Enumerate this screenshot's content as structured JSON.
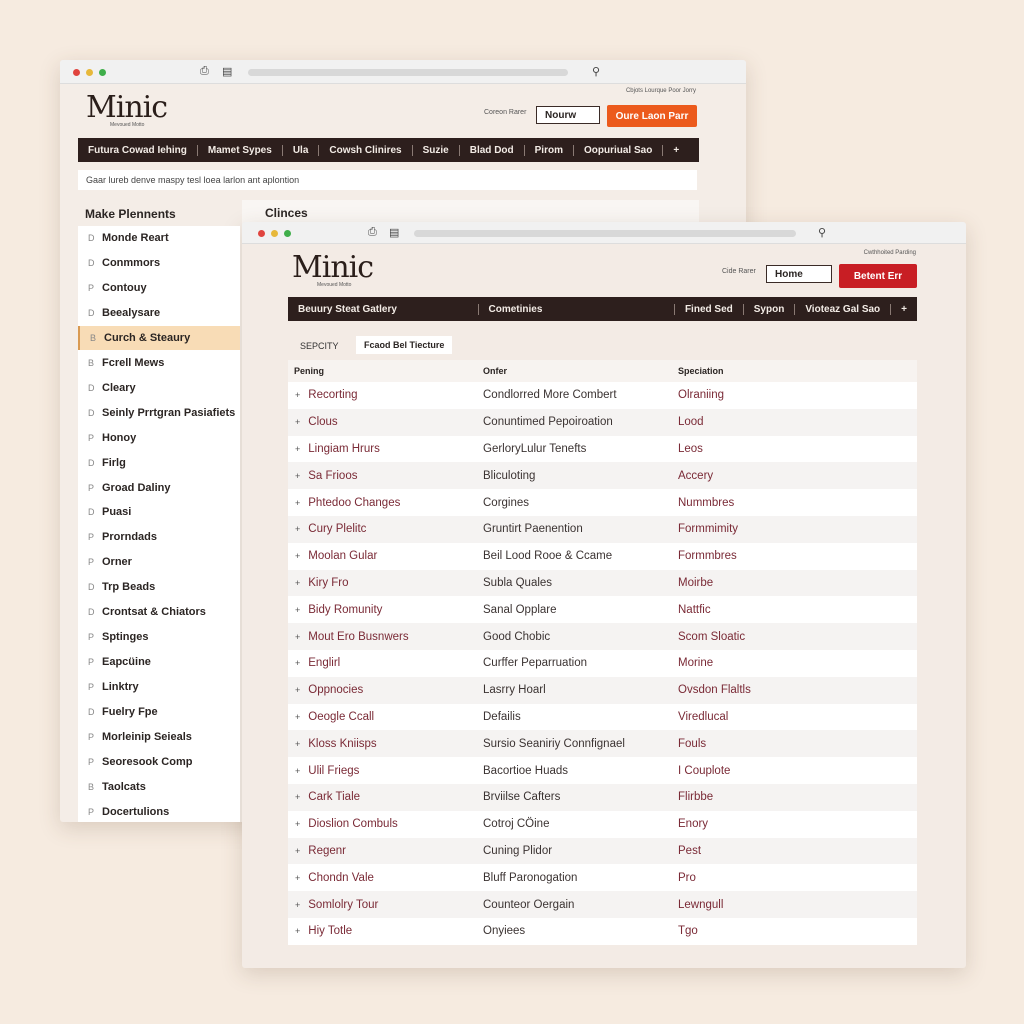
{
  "back_window": {
    "logo": "Minic",
    "logo_sub": "Mevoued Motto",
    "top_right_text": "Cbjots Lourque Poor Jorry",
    "search_label": "Coreon Rarer",
    "search_value": "Nourw",
    "cta_label": "Oure Laon Parr",
    "cta_color": "#ec5a1c",
    "nav": [
      "Futura  Cowad Iehing",
      "Mamet Sypes",
      "Ula",
      "Cowsh Clinires",
      "Suzie",
      "Blad Dod",
      "Pirom",
      "Oopuriual Sao",
      "+"
    ],
    "info_text": "Gaar lureb denve maspy tesl loea larlon ant aplontion",
    "sidebar_title": "Make Plennents",
    "content_title": "Clinces",
    "sidebar_items": [
      {
        "icon": "D",
        "label": "Monde Reart"
      },
      {
        "icon": "D",
        "label": "Conmmors"
      },
      {
        "icon": "P",
        "label": "Contouy"
      },
      {
        "icon": "D",
        "label": "Beealysare"
      },
      {
        "icon": "B",
        "label": "Curch & Steaury",
        "selected": true
      },
      {
        "icon": "B",
        "label": "Fcrell Mews"
      },
      {
        "icon": "D",
        "label": "Cleary"
      },
      {
        "icon": "D",
        "label": "Seinly Prrtgran Pasiafiets"
      },
      {
        "icon": "P",
        "label": "Honoy"
      },
      {
        "icon": "D",
        "label": "Firlg"
      },
      {
        "icon": "P",
        "label": "Groad Daliny"
      },
      {
        "icon": "D",
        "label": "Puasi"
      },
      {
        "icon": "P",
        "label": "Prorndads"
      },
      {
        "icon": "P",
        "label": "Orner"
      },
      {
        "icon": "D",
        "label": "Trp Beads"
      },
      {
        "icon": "D",
        "label": "Crontsat & Chiators"
      },
      {
        "icon": "P",
        "label": "Sptinges"
      },
      {
        "icon": "P",
        "label": "Eapcüine"
      },
      {
        "icon": "P",
        "label": "Linktry"
      },
      {
        "icon": "D",
        "label": "Fuelry Fpe"
      },
      {
        "icon": "P",
        "label": "Morleinip Seieals"
      },
      {
        "icon": "P",
        "label": "Seoresook Comp"
      },
      {
        "icon": "B",
        "label": "Taolcats"
      },
      {
        "icon": "P",
        "label": "Docertulions"
      }
    ]
  },
  "front_window": {
    "logo": "Minic",
    "logo_sub": "Mevoued Motto",
    "top_right_text": "Cwthhoited Parding",
    "search_label": "Cide Rarer",
    "search_value": "Home",
    "cta_label": "Betent Err",
    "cta_color": "#c81e24",
    "nav": [
      "Beuury Steat Gatlery",
      "Cometinies",
      "Fined Sed",
      "Sypon",
      "Vioteaz Gal Sao",
      "+"
    ],
    "tabs": [
      "SEPCITY",
      "Fcaod Bel Tiecture"
    ],
    "columns": [
      "Pening",
      "Onfer",
      "Speciation"
    ],
    "rows": [
      [
        "Recorting",
        "Condlorred More Combert",
        "Olraniing"
      ],
      [
        "Clous",
        "Conuntimed Pepoiroation",
        "Lood"
      ],
      [
        "Lingiam Hrurs",
        "GerloryLulur Tenefts",
        "Leos"
      ],
      [
        "Sa Frioos",
        "Bliculoting",
        "Accery"
      ],
      [
        "Phtedoo Changes",
        "Corgines",
        "Nummbres"
      ],
      [
        "Cury Plelitc",
        "Gruntirt Paenention",
        "Formmimity"
      ],
      [
        "Moolan Gular",
        "Beil Lood Rooe & Ccame",
        "Formmbres"
      ],
      [
        "Kiry Fro",
        "Subla Quales",
        "Moirbe"
      ],
      [
        "Bidy Romunity",
        "Sanal Opplare",
        "Nattfic"
      ],
      [
        "Mout Ero Busnwers",
        "Good Chobic",
        "Scom Sloatic"
      ],
      [
        "Englirl",
        "Curffer Peparruation",
        "Morine"
      ],
      [
        "Oppnocies",
        "Lasrry Hoarl",
        "Ovsdon Flaltls"
      ],
      [
        "Oeogle Ccall",
        "Defailis",
        "Viredlucal"
      ],
      [
        "Kloss Kniisps",
        "Sursio Seaniriy Connfignael",
        "Fouls"
      ],
      [
        "Ulil Friegs",
        "Bacortioe Huads",
        "I Couplote"
      ],
      [
        "Cark Tiale",
        "Brviilse Cafters",
        "Flirbbe"
      ],
      [
        "Dioslion Combuls",
        "Cotroj CÖine",
        "Enory"
      ],
      [
        "Regenr",
        "Cuning Plidor",
        "Pest"
      ],
      [
        "Chondn Vale",
        "Bluff Paronogation",
        "Pro"
      ],
      [
        "Somlolry Tour",
        "Counteor Oergain",
        "Lewngull"
      ],
      [
        "Hiy Totle",
        "Onyiees",
        "Tgo"
      ]
    ]
  }
}
